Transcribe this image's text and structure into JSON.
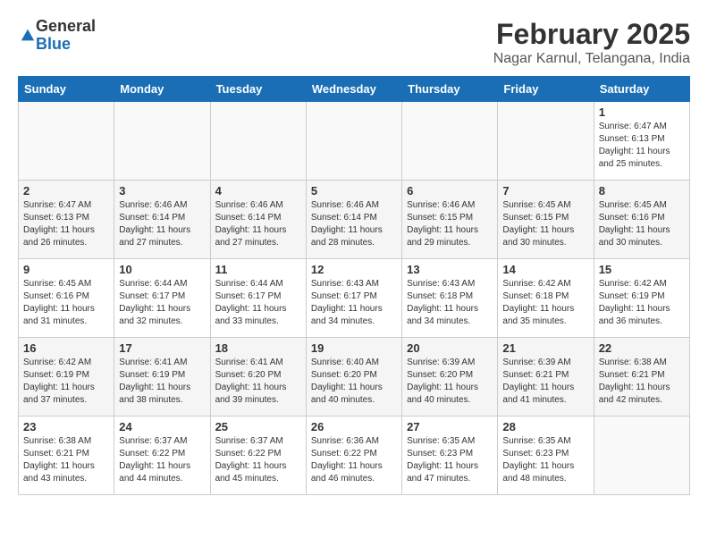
{
  "logo": {
    "general": "General",
    "blue": "Blue"
  },
  "title": "February 2025",
  "subtitle": "Nagar Karnul, Telangana, India",
  "weekdays": [
    "Sunday",
    "Monday",
    "Tuesday",
    "Wednesday",
    "Thursday",
    "Friday",
    "Saturday"
  ],
  "weeks": [
    [
      {
        "day": "",
        "info": ""
      },
      {
        "day": "",
        "info": ""
      },
      {
        "day": "",
        "info": ""
      },
      {
        "day": "",
        "info": ""
      },
      {
        "day": "",
        "info": ""
      },
      {
        "day": "",
        "info": ""
      },
      {
        "day": "1",
        "info": "Sunrise: 6:47 AM\nSunset: 6:13 PM\nDaylight: 11 hours and 25 minutes."
      }
    ],
    [
      {
        "day": "2",
        "info": "Sunrise: 6:47 AM\nSunset: 6:13 PM\nDaylight: 11 hours and 26 minutes."
      },
      {
        "day": "3",
        "info": "Sunrise: 6:46 AM\nSunset: 6:14 PM\nDaylight: 11 hours and 27 minutes."
      },
      {
        "day": "4",
        "info": "Sunrise: 6:46 AM\nSunset: 6:14 PM\nDaylight: 11 hours and 27 minutes."
      },
      {
        "day": "5",
        "info": "Sunrise: 6:46 AM\nSunset: 6:14 PM\nDaylight: 11 hours and 28 minutes."
      },
      {
        "day": "6",
        "info": "Sunrise: 6:46 AM\nSunset: 6:15 PM\nDaylight: 11 hours and 29 minutes."
      },
      {
        "day": "7",
        "info": "Sunrise: 6:45 AM\nSunset: 6:15 PM\nDaylight: 11 hours and 30 minutes."
      },
      {
        "day": "8",
        "info": "Sunrise: 6:45 AM\nSunset: 6:16 PM\nDaylight: 11 hours and 30 minutes."
      }
    ],
    [
      {
        "day": "9",
        "info": "Sunrise: 6:45 AM\nSunset: 6:16 PM\nDaylight: 11 hours and 31 minutes."
      },
      {
        "day": "10",
        "info": "Sunrise: 6:44 AM\nSunset: 6:17 PM\nDaylight: 11 hours and 32 minutes."
      },
      {
        "day": "11",
        "info": "Sunrise: 6:44 AM\nSunset: 6:17 PM\nDaylight: 11 hours and 33 minutes."
      },
      {
        "day": "12",
        "info": "Sunrise: 6:43 AM\nSunset: 6:17 PM\nDaylight: 11 hours and 34 minutes."
      },
      {
        "day": "13",
        "info": "Sunrise: 6:43 AM\nSunset: 6:18 PM\nDaylight: 11 hours and 34 minutes."
      },
      {
        "day": "14",
        "info": "Sunrise: 6:42 AM\nSunset: 6:18 PM\nDaylight: 11 hours and 35 minutes."
      },
      {
        "day": "15",
        "info": "Sunrise: 6:42 AM\nSunset: 6:19 PM\nDaylight: 11 hours and 36 minutes."
      }
    ],
    [
      {
        "day": "16",
        "info": "Sunrise: 6:42 AM\nSunset: 6:19 PM\nDaylight: 11 hours and 37 minutes."
      },
      {
        "day": "17",
        "info": "Sunrise: 6:41 AM\nSunset: 6:19 PM\nDaylight: 11 hours and 38 minutes."
      },
      {
        "day": "18",
        "info": "Sunrise: 6:41 AM\nSunset: 6:20 PM\nDaylight: 11 hours and 39 minutes."
      },
      {
        "day": "19",
        "info": "Sunrise: 6:40 AM\nSunset: 6:20 PM\nDaylight: 11 hours and 40 minutes."
      },
      {
        "day": "20",
        "info": "Sunrise: 6:39 AM\nSunset: 6:20 PM\nDaylight: 11 hours and 40 minutes."
      },
      {
        "day": "21",
        "info": "Sunrise: 6:39 AM\nSunset: 6:21 PM\nDaylight: 11 hours and 41 minutes."
      },
      {
        "day": "22",
        "info": "Sunrise: 6:38 AM\nSunset: 6:21 PM\nDaylight: 11 hours and 42 minutes."
      }
    ],
    [
      {
        "day": "23",
        "info": "Sunrise: 6:38 AM\nSunset: 6:21 PM\nDaylight: 11 hours and 43 minutes."
      },
      {
        "day": "24",
        "info": "Sunrise: 6:37 AM\nSunset: 6:22 PM\nDaylight: 11 hours and 44 minutes."
      },
      {
        "day": "25",
        "info": "Sunrise: 6:37 AM\nSunset: 6:22 PM\nDaylight: 11 hours and 45 minutes."
      },
      {
        "day": "26",
        "info": "Sunrise: 6:36 AM\nSunset: 6:22 PM\nDaylight: 11 hours and 46 minutes."
      },
      {
        "day": "27",
        "info": "Sunrise: 6:35 AM\nSunset: 6:23 PM\nDaylight: 11 hours and 47 minutes."
      },
      {
        "day": "28",
        "info": "Sunrise: 6:35 AM\nSunset: 6:23 PM\nDaylight: 11 hours and 48 minutes."
      },
      {
        "day": "",
        "info": ""
      }
    ]
  ]
}
